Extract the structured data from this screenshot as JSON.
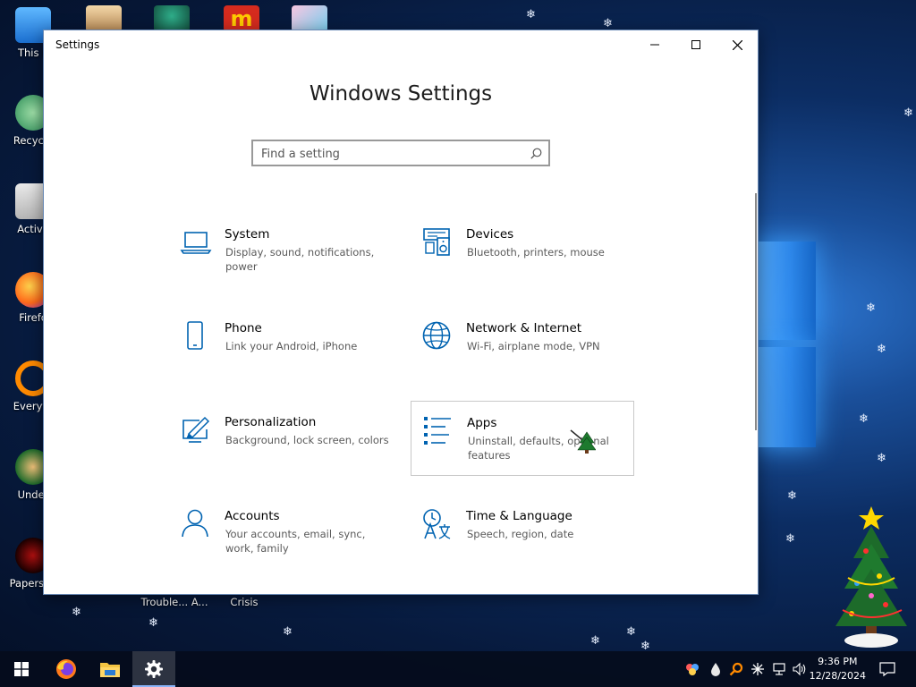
{
  "desktop": {
    "icons_left": [
      {
        "label": "This P",
        "name": "this-pc"
      },
      {
        "label": "Recycle",
        "name": "recycle-bin"
      },
      {
        "label": "Activa",
        "name": "activate"
      },
      {
        "label": "Firefo",
        "name": "firefox"
      },
      {
        "label": "Everyth",
        "name": "everything"
      },
      {
        "label": "Under",
        "name": "undertale"
      },
      {
        "label": "Papers, P",
        "name": "papers-please"
      }
    ],
    "icons_bottom": [
      {
        "label": "Trouble... A..."
      },
      {
        "label": "Crisis"
      }
    ]
  },
  "window": {
    "title": "Settings",
    "minimize_glyph": "—",
    "close_glyph": "✕"
  },
  "main": {
    "heading": "Windows Settings",
    "search_placeholder": "Find a setting"
  },
  "categories": [
    {
      "name": "System",
      "desc": "Display, sound, notifications, power",
      "icon": "laptop-icon"
    },
    {
      "name": "Devices",
      "desc": "Bluetooth, printers, mouse",
      "icon": "devices-icon"
    },
    {
      "name": "Phone",
      "desc": "Link your Android, iPhone",
      "icon": "phone-icon"
    },
    {
      "name": "Network & Internet",
      "desc": "Wi-Fi, airplane mode, VPN",
      "icon": "globe-icon"
    },
    {
      "name": "Personalization",
      "desc": "Background, lock screen, colors",
      "icon": "paint-icon"
    },
    {
      "name": "Apps",
      "desc": "Uninstall, defaults, optional features",
      "icon": "apps-list-icon"
    },
    {
      "name": "Accounts",
      "desc": "Your accounts, email, sync, work, family",
      "icon": "person-icon"
    },
    {
      "name": "Time & Language",
      "desc": "Speech, region, date",
      "icon": "time-language-icon"
    }
  ],
  "taskbar": {
    "clock_time": "9:36 PM",
    "clock_date": "12/28/2024"
  },
  "colors": {
    "accent": "#0063b1",
    "taskbar": "#050c1c"
  }
}
